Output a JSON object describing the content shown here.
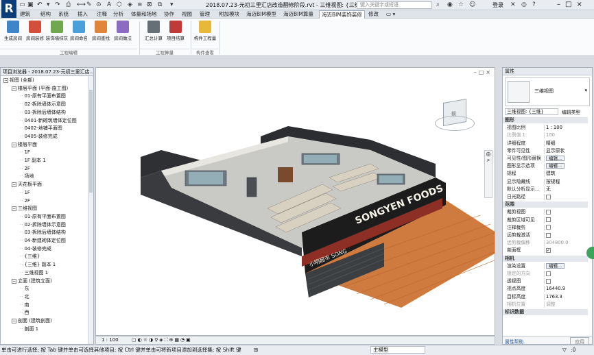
{
  "app": {
    "logo": "R",
    "title": "2018.07.23-元初三里汇店改造翻修阶段.rvt - 三维视图: {三维}",
    "search_placeholder": "键入关键字或短语",
    "user": "登录",
    "window_controls": "–□×"
  },
  "qat": {
    "icons": [
      "open-icon",
      "save-icon",
      "undo-icon",
      "redo-icon",
      "print-icon",
      "measure-icon",
      "text-icon",
      "3d-icon",
      "section-icon",
      "thin-lines-icon",
      "close-hidden-icon",
      "switch-windows-icon"
    ]
  },
  "tabs": [
    "建筑",
    "结构",
    "系统",
    "插入",
    "注释",
    "分析",
    "体量和场地",
    "协作",
    "视图",
    "管理",
    "附加模块",
    "海迈BIM模型",
    "海迈BIM算量",
    "海迈BIM装饰装修",
    "修改"
  ],
  "active_tab": 13,
  "ribbon": {
    "buttons": [
      {
        "label": "生成房间",
        "color": "#3f86c8"
      },
      {
        "label": "房间装修",
        "color": "#d34f3c"
      },
      {
        "label": "装饰墙抹灰",
        "color": "#6fa84e"
      },
      {
        "label": "房间命名",
        "color": "#4aa0d8"
      },
      {
        "label": "房间查找",
        "color": "#e0863a"
      },
      {
        "label": "房间做法",
        "color": "#8a6cc0"
      },
      {
        "label": "汇总计算",
        "color": "#666e78"
      },
      {
        "label": "项目结算",
        "color": "#c03a3a"
      },
      {
        "label": "构件工程量",
        "color": "#e8b83a"
      }
    ],
    "panels": [
      "工程编辑",
      "工程算量",
      "构件查看"
    ]
  },
  "browser": {
    "title": "项目浏览器 - 2018.07.23-元初三里汇店...",
    "tree": [
      {
        "t": "视图 (全部)",
        "lv": 0,
        "g": "−"
      },
      {
        "t": "楼层平面 (平面-施工图)",
        "lv": 1,
        "g": "−"
      },
      {
        "t": "01-原有平面布置图",
        "lv": 2
      },
      {
        "t": "02-拆除墙体示意图",
        "lv": 2
      },
      {
        "t": "03-拆除后墙体结构",
        "lv": 2
      },
      {
        "t": "0401-新砌筑墙体定位图",
        "lv": 2
      },
      {
        "t": "0402-地铺平面图",
        "lv": 2
      },
      {
        "t": "0405-装修完成",
        "lv": 2
      },
      {
        "t": "楼层平面",
        "lv": 1,
        "g": "−"
      },
      {
        "t": "1F",
        "lv": 2
      },
      {
        "t": "1F 副本 1",
        "lv": 2
      },
      {
        "t": "2F",
        "lv": 2
      },
      {
        "t": "场地",
        "lv": 2
      },
      {
        "t": "天花板平面",
        "lv": 1,
        "g": "−"
      },
      {
        "t": "1F",
        "lv": 2
      },
      {
        "t": "2F",
        "lv": 2
      },
      {
        "t": "三维视图",
        "lv": 1,
        "g": "−"
      },
      {
        "t": "01-原有平面布置图",
        "lv": 2
      },
      {
        "t": "02-拆除墙体示意图",
        "lv": 2
      },
      {
        "t": "03-拆除后墙体结构",
        "lv": 2
      },
      {
        "t": "04-新建砌体定位图",
        "lv": 2
      },
      {
        "t": "04-装修完成",
        "lv": 2
      },
      {
        "t": "{三维}",
        "lv": 2
      },
      {
        "t": "{三维} 副本 1",
        "lv": 2
      },
      {
        "t": "三维视图 1",
        "lv": 2
      },
      {
        "t": "立面 (建筑立面)",
        "lv": 1,
        "g": "−"
      },
      {
        "t": "东",
        "lv": 2
      },
      {
        "t": "北",
        "lv": 2
      },
      {
        "t": "南",
        "lv": 2
      },
      {
        "t": "西",
        "lv": 2
      },
      {
        "t": "剖面 (建筑剖面)",
        "lv": 1,
        "g": "−"
      },
      {
        "t": "剖面 1",
        "lv": 2
      }
    ]
  },
  "view": {
    "signage": "SONGYEN FOODS",
    "signage2": "小明超市 SONG",
    "viewcube_label": "前",
    "window_btns": "–□×",
    "scale": "1 : 100"
  },
  "props": {
    "title": "属性",
    "type": "三维视图",
    "selector": "三维视图: {三维}",
    "edit_type": "编辑类型",
    "rows": [
      {
        "cat": "图形"
      },
      {
        "k": "视图比例",
        "v": "1 : 100"
      },
      {
        "k": "比例值 1:",
        "v": "100",
        "dim": true
      },
      {
        "k": "详细程度",
        "v": "精细"
      },
      {
        "k": "零件可见性",
        "v": "显示原状"
      },
      {
        "k": "可见性/图形替换",
        "v": "编辑...",
        "btn": true
      },
      {
        "k": "图形显示选项",
        "v": "编辑...",
        "btn": true
      },
      {
        "k": "规程",
        "v": "建筑"
      },
      {
        "k": "显示隐藏线",
        "v": "按规程"
      },
      {
        "k": "默认分析显示...",
        "v": "无"
      },
      {
        "k": "日光路径",
        "v": "",
        "cb": true
      },
      {
        "cat": "范围"
      },
      {
        "k": "裁剪视图",
        "v": "",
        "cb": true
      },
      {
        "k": "裁剪区域可见",
        "v": "",
        "cb": true
      },
      {
        "k": "注释裁剪",
        "v": "",
        "cb": true
      },
      {
        "k": "远剪裁激活",
        "v": "",
        "cb": true
      },
      {
        "k": "远剪裁偏移",
        "v": "304800.0",
        "dim": true
      },
      {
        "k": "剖面框",
        "v": "✓",
        "cb": true
      },
      {
        "cat": "相机"
      },
      {
        "k": "渲染设置",
        "v": "编辑...",
        "btn": true
      },
      {
        "k": "锁定的方向",
        "v": "",
        "cb": true,
        "dim": true
      },
      {
        "k": "透视图",
        "v": "",
        "cb": true
      },
      {
        "k": "视点高度",
        "v": "16440.9"
      },
      {
        "k": "目标高度",
        "v": "1763.3"
      },
      {
        "k": "相机位置",
        "v": "调整",
        "dim": true
      },
      {
        "cat": "标识数据"
      }
    ],
    "help": "属性帮助",
    "apply": "应用"
  },
  "status": {
    "text": "单击可进行选择; 按 Tab 键并单击可选择其他项目; 按 Ctrl 键并单击可将新项目添加到选择集; 按 Shift 键",
    "model": "主模型",
    "filter": ":0"
  }
}
